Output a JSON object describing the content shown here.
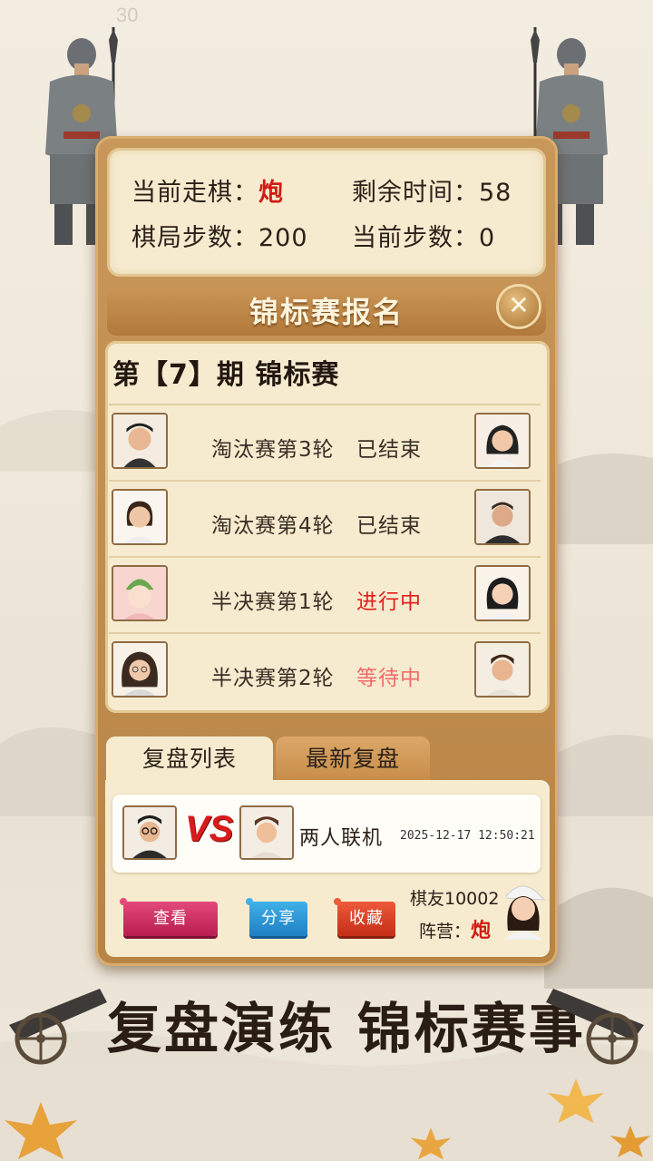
{
  "watermark": "30",
  "info": {
    "current_piece_label": "当前走棋：",
    "current_piece_value": "炮",
    "time_left_label": "剩余时间：",
    "time_left_value": "58",
    "game_steps_label": "棋局步数：",
    "game_steps_value": "200",
    "current_step_label": "当前步数：",
    "current_step_value": "0"
  },
  "dialog": {
    "title": "锦标赛报名",
    "close_icon": "close-icon",
    "period_title": "第【7】期 锦标赛",
    "matches": [
      {
        "round": "淘汰赛第3轮",
        "status": "已结束",
        "status_color": "#3a2e25"
      },
      {
        "round": "淘汰赛第4轮",
        "status": "已结束",
        "status_color": "#3a2e25"
      },
      {
        "round": "半决赛第1轮",
        "status": "进行中",
        "status_color": "#e0201c"
      },
      {
        "round": "半决赛第2轮",
        "status": "等待中",
        "status_color": "#f06a6a"
      }
    ]
  },
  "replay": {
    "tabs": [
      {
        "label": "复盘列表",
        "active": true
      },
      {
        "label": "最新复盘",
        "active": false
      }
    ],
    "vs_text": "VS",
    "mode": "两人联机",
    "datetime": "2025-12-17 12:50:21",
    "buttons": {
      "view": "查看",
      "share": "分享",
      "favorite": "收藏"
    },
    "player_name": "棋友10002",
    "camp_label": "阵营：",
    "camp_value": "炮"
  },
  "slogan": "复盘演练 锦标赛事",
  "colors": {
    "panel": "#b88446",
    "cream": "#f6ebcf",
    "red": "#d21b14"
  }
}
